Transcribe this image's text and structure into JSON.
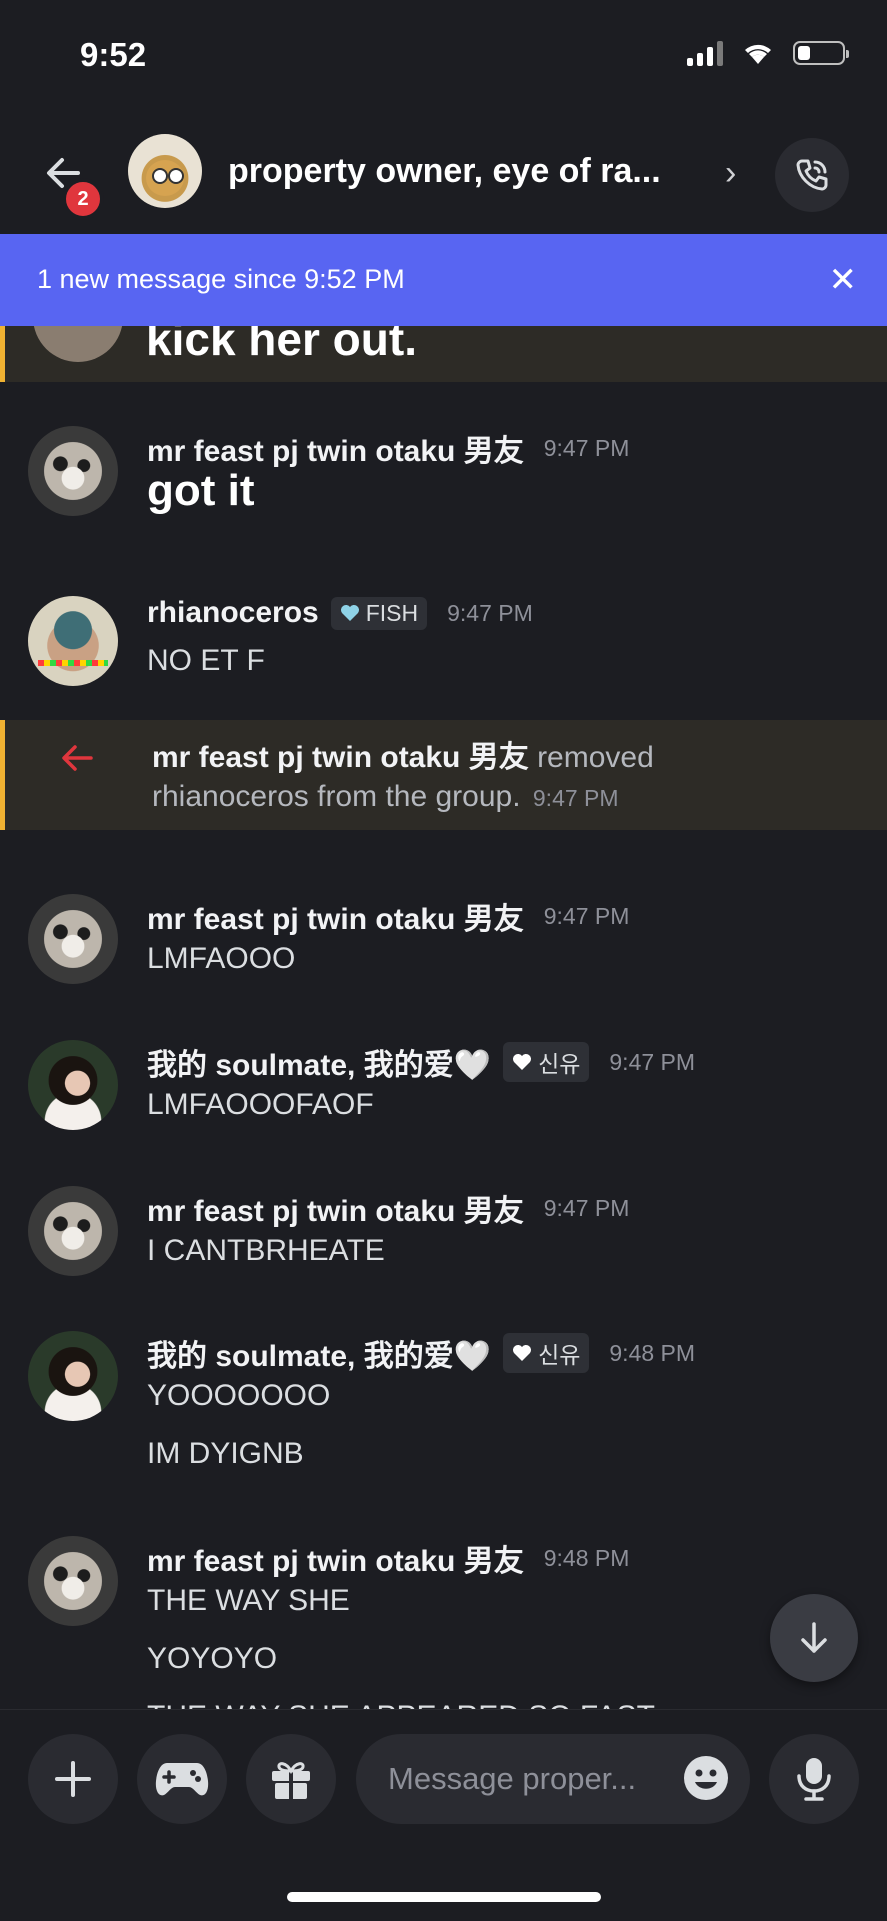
{
  "status": {
    "time": "9:52"
  },
  "header": {
    "back_badge": "2",
    "group_title": "property owner, eye of ra...",
    "chevron": "›"
  },
  "banner": {
    "text": "1 new message since 9:52 PM",
    "close": "✕"
  },
  "previous_message": {
    "text": "kick her out."
  },
  "messages": [
    {
      "author": "mr feast pj twin otaku 男友",
      "time": "9:47 PM",
      "lines": [
        "got it"
      ],
      "avatar": "rabbit",
      "big": true
    },
    {
      "author": "rhianoceros",
      "tag": "FISH",
      "tag_color": "#8fd3e8",
      "time": "9:47 PM",
      "lines": [
        "NO ET F"
      ],
      "avatar": "rhino"
    },
    {
      "author": "mr feast pj twin otaku 男友",
      "time": "9:47 PM",
      "lines": [
        "LMFAOOO"
      ],
      "avatar": "rabbit"
    },
    {
      "author": "我的 soulmate, 我的爱🤍",
      "tag": "신유",
      "tag_color": "#ffffff",
      "time": "9:47 PM",
      "lines": [
        "LMFAOOOFAOF"
      ],
      "avatar": "girl"
    },
    {
      "author": "mr feast pj twin otaku 男友",
      "time": "9:47 PM",
      "lines": [
        "I CANTBRHEATE"
      ],
      "avatar": "rabbit"
    },
    {
      "author": "我的 soulmate, 我的爱🤍",
      "tag": "신유",
      "tag_color": "#ffffff",
      "time": "9:48 PM",
      "lines": [
        "YOOOOOOO",
        "IM DYIGNB"
      ],
      "avatar": "girl"
    },
    {
      "author": "mr feast pj twin otaku 男友",
      "time": "9:48 PM",
      "lines": [
        "THE WAY SHE",
        "YOYOYO",
        "THE WAY SHE APPEARED SO FAST"
      ],
      "avatar": "rabbit"
    }
  ],
  "system_message": {
    "actor": "mr feast pj twin otaku 男友",
    "action": "removed",
    "target": "rhianoceros",
    "rest": "from the group.",
    "time": "9:47 PM"
  },
  "composer": {
    "placeholder": "Message proper..."
  },
  "colors": {
    "accent": "#5865f2",
    "highlight_border": "#f0b232",
    "badge": "#e0363d",
    "remove_arrow": "#e0363d"
  },
  "icons": [
    "back-arrow-icon",
    "phone-call-icon",
    "close-icon",
    "remove-arrow-icon",
    "arrow-down-icon",
    "plus-icon",
    "gamepad-icon",
    "gift-icon",
    "emoji-icon",
    "microphone-icon"
  ]
}
